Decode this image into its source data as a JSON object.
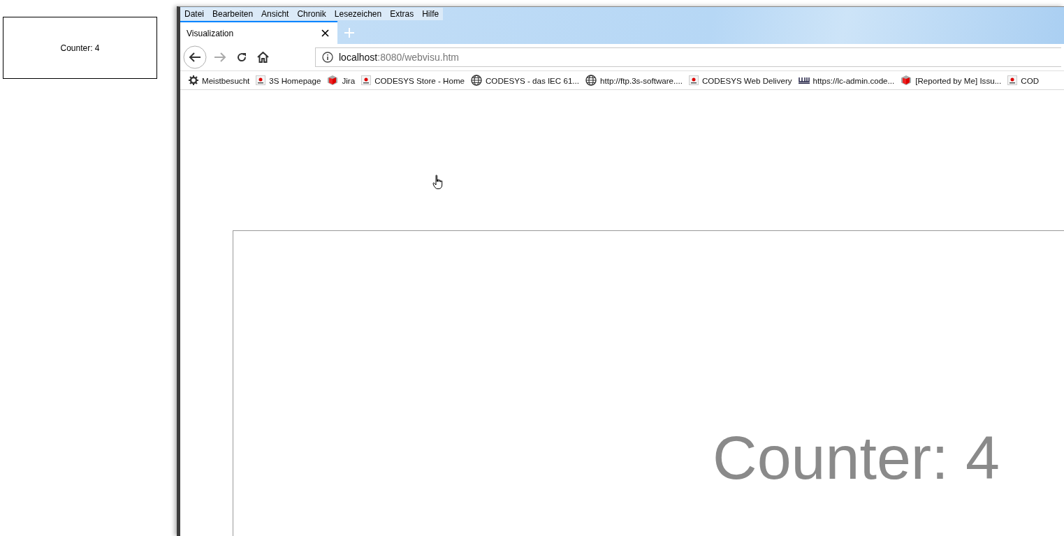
{
  "preview": {
    "text": "Counter: 4"
  },
  "menu_bar": [
    {
      "label": "Datei"
    },
    {
      "label": "Bearbeiten"
    },
    {
      "label": "Ansicht"
    },
    {
      "label": "Chronik"
    },
    {
      "label": "Lesezeichen"
    },
    {
      "label": "Extras"
    },
    {
      "label": "Hilfe"
    }
  ],
  "tabs": [
    {
      "title": "Visualization",
      "selected": true
    }
  ],
  "address_bar": {
    "host": "localhost",
    "rest": ":8080/webvisu.htm"
  },
  "bookmarks": [
    {
      "label": "Meistbesucht",
      "kind": "gear"
    },
    {
      "label": "3S Homepage",
      "kind": "codesys"
    },
    {
      "label": "Jira",
      "kind": "cube"
    },
    {
      "label": "CODESYS Store - Home",
      "kind": "codesys"
    },
    {
      "label": "CODESYS - das IEC 61...",
      "kind": "globe"
    },
    {
      "label": "http://ftp.3s-software....",
      "kind": "globe"
    },
    {
      "label": "CODESYS Web Delivery",
      "kind": "codesys"
    },
    {
      "label": "https://lc-admin.code...",
      "kind": "wibu"
    },
    {
      "label": "[Reported by Me] Issu...",
      "kind": "cube"
    },
    {
      "label": "COD",
      "kind": "codesys"
    }
  ],
  "visualization": {
    "text": "Counter: 4"
  }
}
